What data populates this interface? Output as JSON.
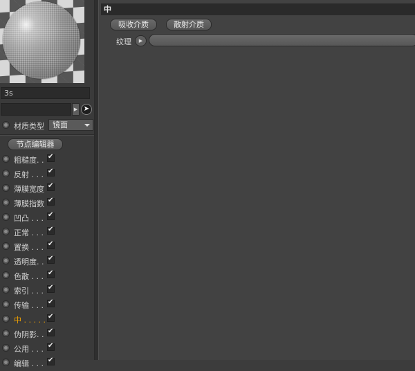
{
  "material": {
    "name": "3s",
    "type_label": "材质类型",
    "type_value": "镜面",
    "node_editor_label": "节点编辑器"
  },
  "channels": [
    {
      "label": "粗糙度. .",
      "enabled": true,
      "active": false
    },
    {
      "label": "反射 . . .",
      "enabled": true,
      "active": false
    },
    {
      "label": "薄膜宽度",
      "enabled": true,
      "active": false
    },
    {
      "label": "薄膜指数",
      "enabled": true,
      "active": false
    },
    {
      "label": "凹凸 . . .",
      "enabled": true,
      "active": false
    },
    {
      "label": "正常 . . .",
      "enabled": true,
      "active": false
    },
    {
      "label": "置换 . . .",
      "enabled": true,
      "active": false
    },
    {
      "label": "透明度. .",
      "enabled": true,
      "active": false
    },
    {
      "label": "色散 . . .",
      "enabled": true,
      "active": false
    },
    {
      "label": "索引 . . .",
      "enabled": true,
      "active": false
    },
    {
      "label": "传输 . . .",
      "enabled": true,
      "active": false
    },
    {
      "label": "中 . . . . .",
      "enabled": true,
      "active": true
    },
    {
      "label": "伪阴影. .",
      "enabled": true,
      "active": false
    },
    {
      "label": "公用 . . .",
      "enabled": true,
      "active": false
    },
    {
      "label": "编辑 . . .",
      "enabled": true,
      "active": false
    }
  ],
  "panel": {
    "title": "中",
    "absorb_button": "吸收介质",
    "scatter_button": "散射介质",
    "texture_label": "纹理"
  },
  "colors": {
    "active_channel": "#f2a200",
    "background": "#424242"
  }
}
